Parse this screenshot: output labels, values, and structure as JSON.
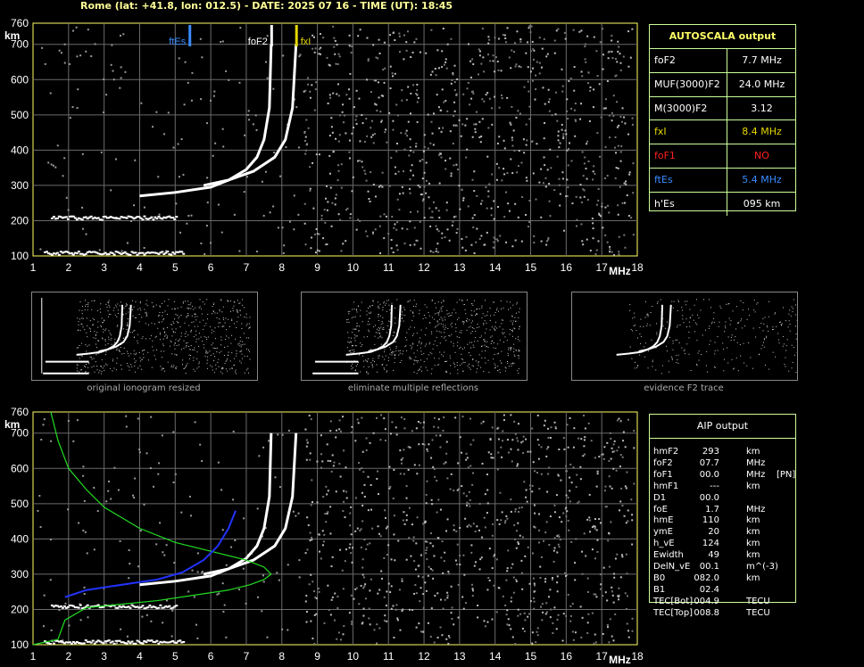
{
  "header": "Rome (lat: +41.8, lon: 012.5) - DATE: 2025 07 16 - TIME (UT): 18:45",
  "autoscala": {
    "title": "AUTOSCALA output",
    "rows": [
      {
        "label": "foF2",
        "value": "7.7 MHz",
        "color": "#ffffff"
      },
      {
        "label": "MUF(3000)F2",
        "value": "24.0 MHz",
        "color": "#ffffff"
      },
      {
        "label": "M(3000)F2",
        "value": "3.12",
        "color": "#ffffff"
      },
      {
        "label": "fxI",
        "value": "8.4 MHz",
        "color": "#e6d800"
      },
      {
        "label": "foF1",
        "value": "NO",
        "color": "#ff2020"
      },
      {
        "label": "ftEs",
        "value": "5.4 MHz",
        "color": "#3a8cff"
      },
      {
        "label": "h'Es",
        "value": "095    km",
        "color": "#ffffff"
      }
    ]
  },
  "thumb_captions": [
    "original ionogram resized",
    "eliminate multiple reflections",
    "evidence F2 trace"
  ],
  "aip": {
    "title": "AIP output",
    "rows": [
      {
        "name": "hmF2",
        "value": "293",
        "unit": "km",
        "extra": ""
      },
      {
        "name": "foF2",
        "value": "07.7",
        "unit": "MHz",
        "extra": ""
      },
      {
        "name": "foF1",
        "value": "00.0",
        "unit": "MHz",
        "extra": "[PN]"
      },
      {
        "name": "hmF1",
        "value": "---",
        "unit": "km",
        "extra": ""
      },
      {
        "name": "D1",
        "value": "00.0",
        "unit": "",
        "extra": ""
      },
      {
        "name": "foE",
        "value": "1.7",
        "unit": "MHz",
        "extra": ""
      },
      {
        "name": "hmE",
        "value": "110",
        "unit": "km",
        "extra": ""
      },
      {
        "name": "ymE",
        "value": "20",
        "unit": "km",
        "extra": ""
      },
      {
        "name": "h_vE",
        "value": "124",
        "unit": "km",
        "extra": ""
      },
      {
        "name": "Ewidth",
        "value": "49",
        "unit": "km",
        "extra": ""
      },
      {
        "name": "DelN_vE",
        "value": "00.1",
        "unit": "m^(-3)",
        "extra": ""
      },
      {
        "name": "B0",
        "value": "082.0",
        "unit": "km",
        "extra": ""
      },
      {
        "name": "B1",
        "value": "02.4",
        "unit": "",
        "extra": ""
      },
      {
        "name": "TEC[Bot]",
        "value": "004.9",
        "unit": "TECU",
        "extra": ""
      },
      {
        "name": "TEC[Top]",
        "value": "008.8",
        "unit": "TECU",
        "extra": ""
      }
    ]
  },
  "chart_data": [
    {
      "type": "scatter",
      "title": "",
      "xlabel": "MHz",
      "ylabel": "km",
      "xlim": [
        1,
        18
      ],
      "ylim": [
        100,
        760
      ],
      "x_ticks": [
        1,
        2,
        3,
        4,
        5,
        6,
        7,
        8,
        9,
        10,
        11,
        12,
        13,
        14,
        15,
        16,
        17,
        18
      ],
      "y_ticks": [
        100,
        200,
        300,
        400,
        500,
        600,
        700,
        760
      ],
      "grid": true,
      "markers": [
        {
          "name": "ftEs",
          "x": 5.4,
          "color": "#3a8cff"
        },
        {
          "name": "foF2",
          "x": 7.7,
          "color": "#ffffff"
        },
        {
          "name": "fxI",
          "x": 8.4,
          "color": "#e6d800"
        }
      ],
      "series": [
        {
          "name": "O-trace",
          "x": [
            4.0,
            5.0,
            6.0,
            6.5,
            7.0,
            7.3,
            7.5,
            7.65,
            7.7
          ],
          "y": [
            270,
            280,
            295,
            315,
            345,
            380,
            430,
            520,
            700
          ]
        },
        {
          "name": "X-trace",
          "x": [
            5.8,
            6.5,
            7.2,
            7.8,
            8.1,
            8.3,
            8.4
          ],
          "y": [
            300,
            315,
            340,
            380,
            430,
            520,
            700
          ]
        }
      ]
    },
    {
      "type": "line",
      "title": "",
      "xlabel": "MHz",
      "ylabel": "km",
      "xlim": [
        1,
        18
      ],
      "ylim": [
        100,
        760
      ],
      "x_ticks": [
        1,
        2,
        3,
        4,
        5,
        6,
        7,
        8,
        9,
        10,
        11,
        12,
        13,
        14,
        15,
        16,
        17,
        18
      ],
      "y_ticks": [
        100,
        200,
        300,
        400,
        500,
        600,
        700,
        760
      ],
      "grid": true,
      "series": [
        {
          "name": "profile",
          "x": [
            1.0,
            1.7,
            1.9,
            2.5,
            3.5,
            4.5,
            5.5,
            6.5,
            7.1,
            7.5,
            7.7,
            7.5,
            7.0,
            6.0,
            5.0,
            4.0,
            3.0,
            2.5,
            2.0,
            1.7,
            1.5
          ],
          "y": [
            100,
            115,
            170,
            205,
            215,
            225,
            240,
            255,
            270,
            285,
            300,
            320,
            340,
            365,
            390,
            430,
            490,
            540,
            600,
            680,
            760
          ]
        },
        {
          "name": "trace-fit",
          "x": [
            1.9,
            2.5,
            3.5,
            4.5,
            5.2,
            5.8,
            6.2,
            6.5,
            6.7
          ],
          "y": [
            235,
            255,
            270,
            285,
            305,
            340,
            380,
            430,
            480
          ]
        }
      ]
    }
  ]
}
